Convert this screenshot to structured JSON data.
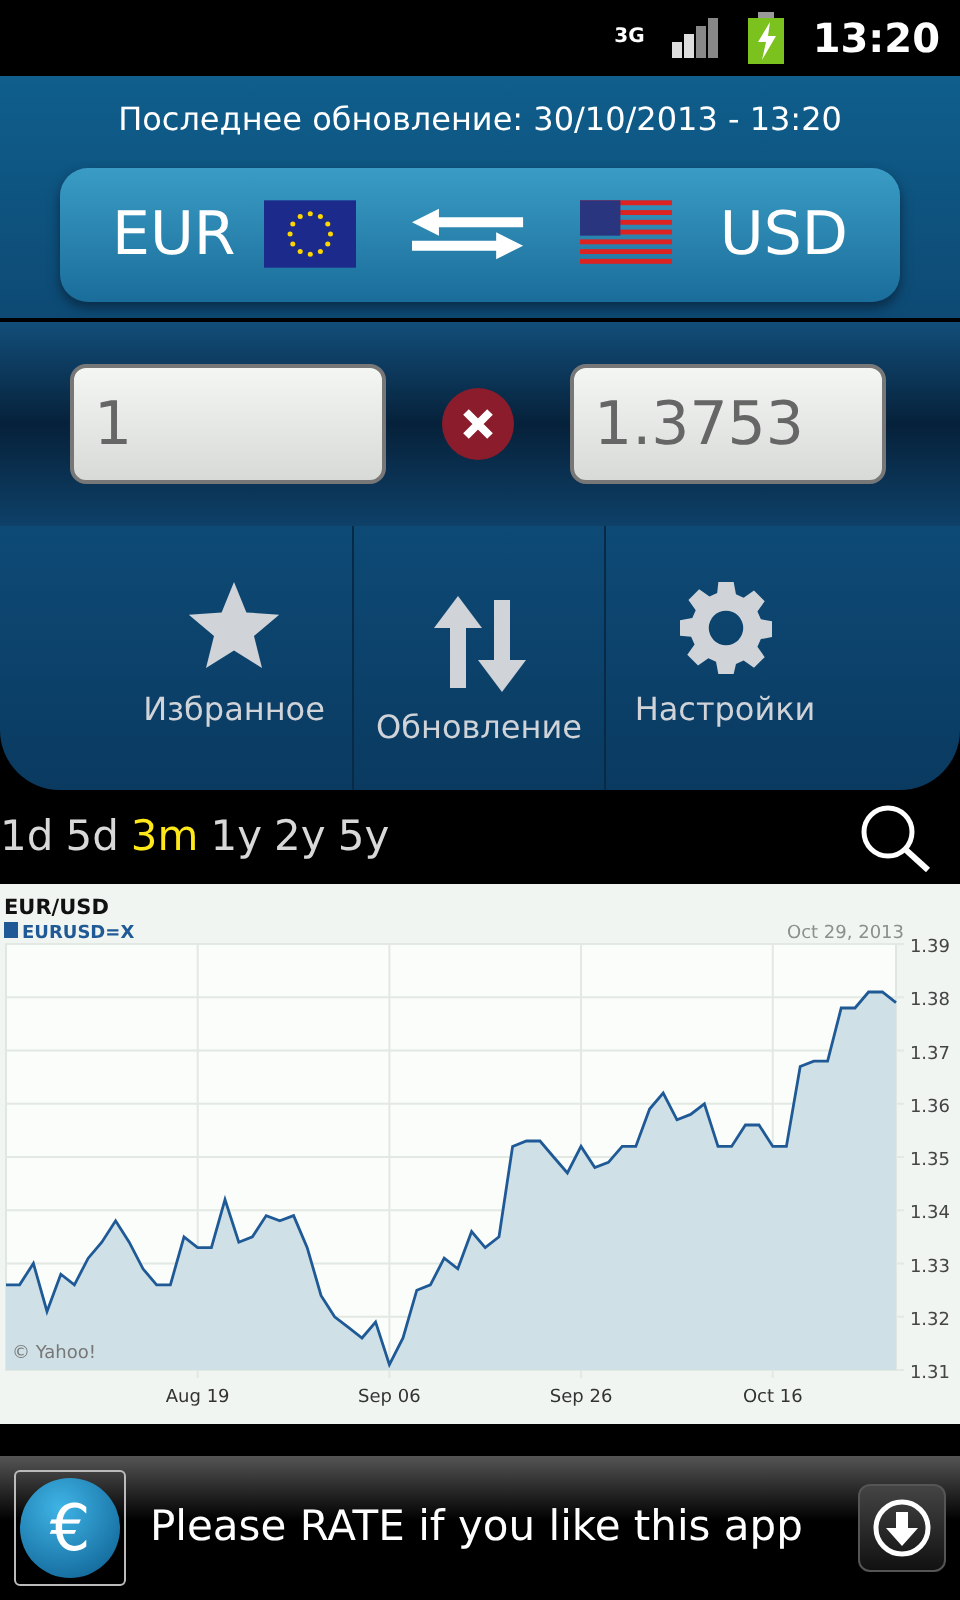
{
  "status_bar": {
    "network": "3G",
    "time": "13:20"
  },
  "header": {
    "last_update": "Последнее обновление: 30/10/2013 - 13:20"
  },
  "currency_pair": {
    "from": "EUR",
    "to": "USD"
  },
  "converter": {
    "amount": "1",
    "result": "1.3753"
  },
  "nav": [
    {
      "label": "Избранное",
      "kind": "star"
    },
    {
      "label": "Обновление",
      "kind": "refresh"
    },
    {
      "label": "Настройки",
      "kind": "settings"
    }
  ],
  "ranges": [
    {
      "label": "1d",
      "selected": false
    },
    {
      "label": "5d",
      "selected": false
    },
    {
      "label": "3m",
      "selected": true
    },
    {
      "label": "1y",
      "selected": false
    },
    {
      "label": "2y",
      "selected": false
    },
    {
      "label": "5y",
      "selected": false
    }
  ],
  "chart": {
    "date": "Oct 29, 2013",
    "credit": "© Yahoo!",
    "chart_data": {
      "type": "area",
      "title": "EUR/USD",
      "grid": true,
      "categories": [
        null,
        null,
        null,
        null,
        null,
        null,
        null,
        null,
        null,
        null,
        null,
        null,
        null,
        null,
        "Aug 19",
        null,
        null,
        null,
        null,
        null,
        null,
        null,
        null,
        null,
        null,
        null,
        null,
        null,
        "Sep 06",
        null,
        null,
        null,
        null,
        null,
        null,
        null,
        null,
        null,
        null,
        null,
        null,
        null,
        "Sep 26",
        null,
        null,
        null,
        null,
        null,
        null,
        null,
        null,
        null,
        null,
        null,
        null,
        null,
        "Oct 16",
        null,
        null,
        null,
        null,
        null,
        null,
        null,
        null,
        null
      ],
      "ylim": [
        1.31,
        1.39
      ],
      "yticks": [
        1.31,
        1.32,
        1.33,
        1.34,
        1.35,
        1.36,
        1.37,
        1.38,
        1.39
      ],
      "series": [
        {
          "name": "EURUSD=X",
          "color": "#1f5a96",
          "values": [
            1.326,
            1.326,
            1.33,
            1.321,
            1.328,
            1.326,
            1.331,
            1.334,
            1.338,
            1.334,
            1.329,
            1.326,
            1.326,
            1.335,
            1.333,
            1.333,
            1.342,
            1.334,
            1.335,
            1.339,
            1.338,
            1.339,
            1.333,
            1.324,
            1.32,
            1.318,
            1.316,
            1.319,
            1.311,
            1.316,
            1.325,
            1.326,
            1.331,
            1.329,
            1.336,
            1.333,
            1.335,
            1.352,
            1.353,
            1.353,
            1.35,
            1.347,
            1.352,
            1.348,
            1.349,
            1.352,
            1.352,
            1.359,
            1.362,
            1.357,
            1.358,
            1.36,
            1.352,
            1.352,
            1.356,
            1.356,
            1.352,
            1.352,
            1.367,
            1.368,
            1.368,
            1.378,
            1.378,
            1.381,
            1.381,
            1.379
          ]
        }
      ]
    }
  },
  "ad": {
    "logo_symbol": "€",
    "text": "Please RATE if you like this app"
  }
}
